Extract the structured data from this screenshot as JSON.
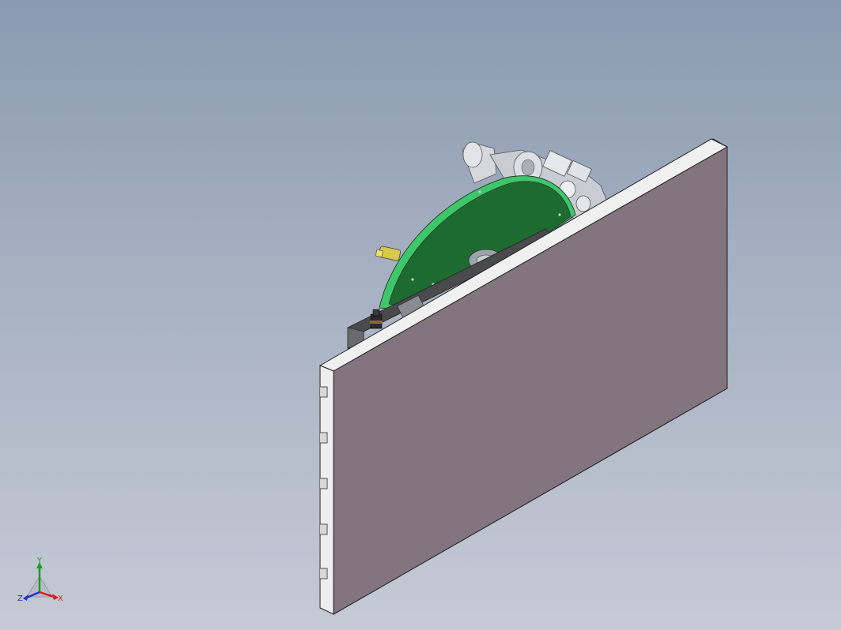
{
  "viewport": {
    "background_top": "#8a9ab0",
    "background_bottom": "#c5cad5"
  },
  "model": {
    "plate_front_color": "#82757f",
    "plate_edge_color": "#f0f0f0",
    "disc_color": "#1e6b32",
    "disc_rim_color": "#3ec76a",
    "fitting_color": "#d8c94a",
    "body_color": "#c9ccd2",
    "slot_count": 5
  },
  "triad": {
    "x_label": "X",
    "y_label": "Y",
    "z_label": "Z",
    "x_color": "#d42020",
    "y_color": "#18a020",
    "z_color": "#2030c8"
  }
}
